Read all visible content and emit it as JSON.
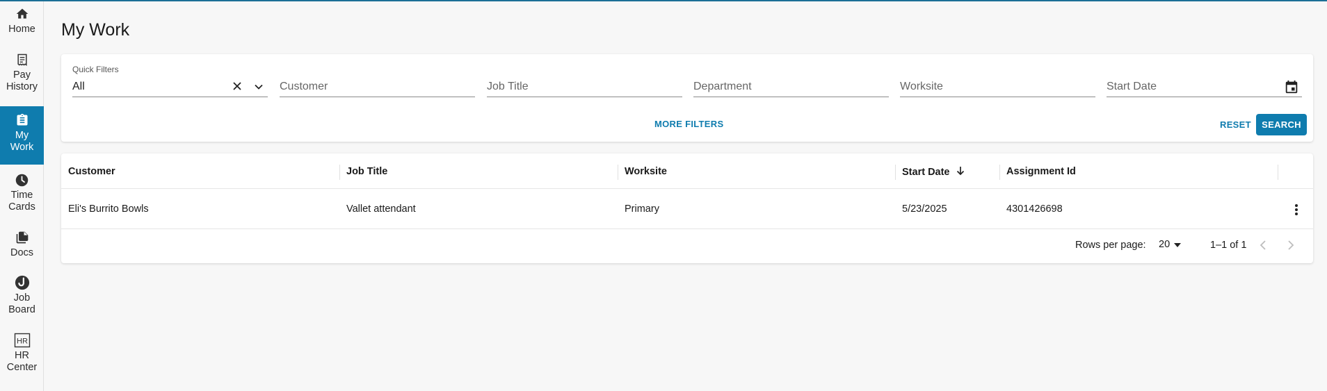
{
  "colors": {
    "accent": "#0f7cae",
    "active_nav_bg": "#0f7cae",
    "page_bg": "#f7f7f7"
  },
  "sidebar": {
    "items": [
      {
        "label": "Home",
        "icon": "home-icon"
      },
      {
        "label": "Pay\nHistory",
        "icon": "receipt-icon"
      },
      {
        "label": "My\nWork",
        "icon": "clipboard-icon",
        "active": true
      },
      {
        "label": "Time\nCards",
        "icon": "clock-icon"
      },
      {
        "label": "Docs",
        "icon": "documents-icon"
      },
      {
        "label": "Job\nBoard",
        "icon": "job-board-logo-icon"
      },
      {
        "label": "HR\nCenter",
        "icon": "hr-icon",
        "icon_text": "HR"
      }
    ]
  },
  "page": {
    "title": "My Work"
  },
  "filters": {
    "quick_filters_label": "Quick Filters",
    "quick_filters_value": "All",
    "customer_placeholder": "Customer",
    "job_title_placeholder": "Job Title",
    "department_placeholder": "Department",
    "worksite_placeholder": "Worksite",
    "start_date_placeholder": "Start Date",
    "more_filters_label": "MORE FILTERS",
    "reset_label": "RESET",
    "search_label": "SEARCH"
  },
  "table": {
    "columns": [
      "Customer",
      "Job Title",
      "Worksite",
      "Start Date",
      "Assignment Id"
    ],
    "sorted_column": "Start Date",
    "sort_direction": "descending",
    "rows": [
      {
        "customer": "Eli's Burrito Bowls",
        "job_title": "Vallet attendant",
        "worksite": "Primary",
        "start_date": "5/23/2025",
        "assignment_id": "4301426698"
      }
    ]
  },
  "pagination": {
    "rows_per_page_label": "Rows per page:",
    "rows_per_page_value": "20",
    "range_text": "1–1 of 1"
  }
}
